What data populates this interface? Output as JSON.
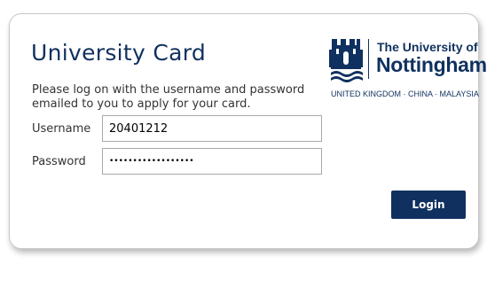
{
  "page": {
    "title": "University Card",
    "instructions": "Please log on with the username and password emailed to you to apply for your card."
  },
  "logo": {
    "line1": "The University of",
    "line2": "Nottingham",
    "campuses": "UNITED KINGDOM · CHINA · MALAYSIA",
    "icon": "castle-crest-icon"
  },
  "form": {
    "username_label": "Username",
    "username_value": "20401212",
    "password_label": "Password",
    "password_value": "••••••••••••••••••",
    "login_label": "Login"
  },
  "colors": {
    "brand": "#10315f",
    "background": "#ffffff",
    "border": "#c8c8c8"
  }
}
